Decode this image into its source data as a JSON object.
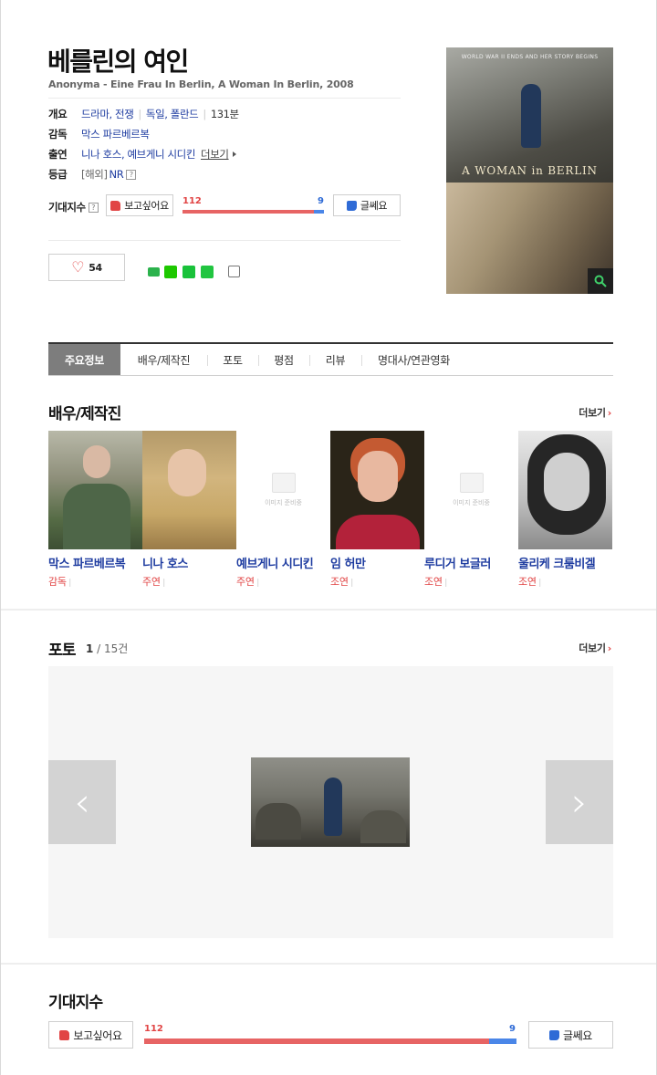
{
  "movie": {
    "title": "베를린의 여인",
    "subtitle": "Anonyma - Eine Frau In Berlin, A Woman In Berlin, 2008",
    "info": {
      "overview_label": "개요",
      "genres": "드라마, 전쟁",
      "countries": "독일, 폴란드",
      "runtime": "131분",
      "director_label": "감독",
      "director": "막스 파르베르복",
      "cast_label": "출연",
      "cast": "니나 호스, 예브게니 시디킨",
      "cast_more": "더보기",
      "rating_label": "등급",
      "rating_region": "[해외]",
      "rating": "NR"
    },
    "expect": {
      "label": "기대지수",
      "want_label": "보고싶어요",
      "want_count": "112",
      "notsure_label": "글쎄요",
      "notsure_count": "9",
      "want_ratio": 0.926
    },
    "likes": "54",
    "poster": {
      "tagline": "WORLD WAR II ENDS AND HER STORY BEGINS",
      "title": "A WOMAN in BERLIN"
    }
  },
  "tabs": [
    "주요정보",
    "배우/제작진",
    "포토",
    "평점",
    "리뷰",
    "명대사/연관영화"
  ],
  "cast_section": {
    "title": "배우/제작진",
    "more": "더보기",
    "people": [
      {
        "name": "막스 파르베르복",
        "role": "감독"
      },
      {
        "name": "니나 호스",
        "role": "주연"
      },
      {
        "name": "예브게니 시디킨",
        "role": "주연"
      },
      {
        "name": "임 허만",
        "role": "조연"
      },
      {
        "name": "루디거 보글러",
        "role": "조연"
      },
      {
        "name": "울리케 크룸비겔",
        "role": "조연"
      }
    ],
    "no_image_text": "이미지 준비중"
  },
  "photo_section": {
    "title": "포토",
    "current": "1",
    "total": "15건",
    "more": "더보기"
  },
  "expect_section": {
    "title": "기대지수",
    "want_label": "보고싶어요",
    "want_count": "112",
    "notsure_label": "글쎄요",
    "notsure_count": "9"
  },
  "colors": {
    "accent_red": "#e14444",
    "link_blue": "#1e3ca0",
    "bar_red": "#e76464",
    "bar_blue": "#4a86e8"
  }
}
